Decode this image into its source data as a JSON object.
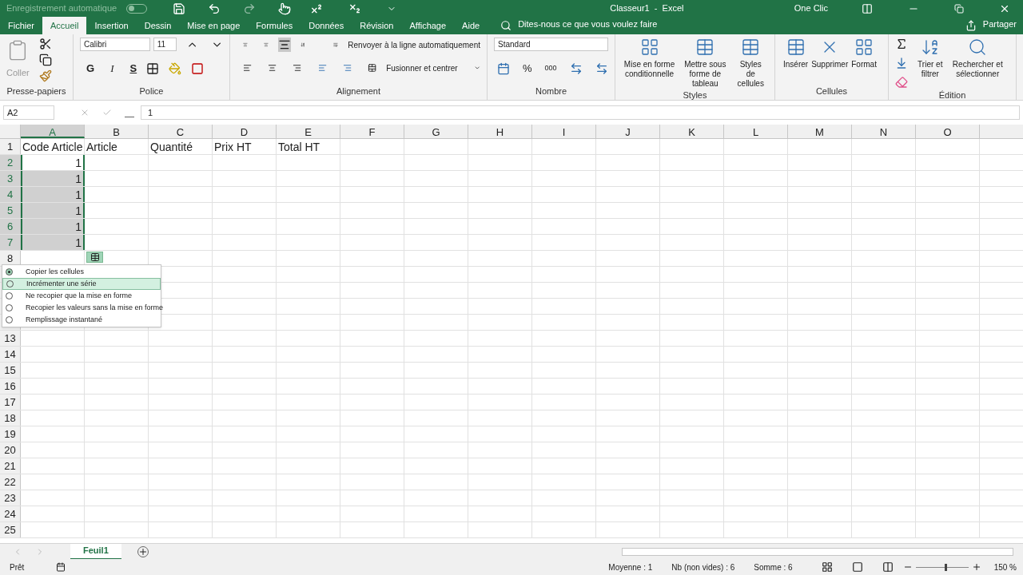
{
  "title_bar": {
    "autosave_label": "Enregistrement automatique",
    "autosave_on": false,
    "title": "Classeur1  -  Excel",
    "user": "One Clic"
  },
  "menu_tabs": [
    {
      "label": "Fichier",
      "selected": false
    },
    {
      "label": "Accueil",
      "selected": true
    },
    {
      "label": "Insertion",
      "selected": false
    },
    {
      "label": "Dessin",
      "selected": false
    },
    {
      "label": "Mise en page",
      "selected": false
    },
    {
      "label": "Formules",
      "selected": false
    },
    {
      "label": "Données",
      "selected": false
    },
    {
      "label": "Révision",
      "selected": false
    },
    {
      "label": "Affichage",
      "selected": false
    },
    {
      "label": "Aide",
      "selected": false
    }
  ],
  "tell_me": "Dites-nous ce que vous voulez faire",
  "share": "Partager",
  "ribbon": {
    "clipboard": {
      "paste": "Coller",
      "label": "Presse-papiers"
    },
    "font": {
      "name": "Calibri",
      "size": "11",
      "bold": "G",
      "italic": "I",
      "underline": "S",
      "label": "Police"
    },
    "alignment": {
      "wrap": "Renvoyer à la ligne automatiquement",
      "merge": "Fusionner et centrer",
      "label": "Alignement"
    },
    "number": {
      "format": "Standard",
      "percent": "%",
      "thousands": "000",
      "label": "Nombre"
    },
    "styles": {
      "buttons": [
        "Mise en forme conditionnelle",
        "Mettre sous forme de tableau",
        "Styles de cellules"
      ],
      "label": "Styles"
    },
    "cells": {
      "buttons": [
        "Insérer",
        "Supprimer",
        "Format"
      ],
      "label": "Cellules"
    },
    "editing": {
      "buttons": [
        "Trier et filtrer",
        "Rechercher et sélectionner"
      ],
      "label": "Édition"
    }
  },
  "formula_bar": {
    "name_box": "A2",
    "value": "1"
  },
  "columns": [
    {
      "label": "A",
      "selected": true
    },
    {
      "label": "B",
      "selected": false
    },
    {
      "label": "C",
      "selected": false
    },
    {
      "label": "D",
      "selected": false
    },
    {
      "label": "E",
      "selected": false
    },
    {
      "label": "F",
      "selected": false
    },
    {
      "label": "G",
      "selected": false
    },
    {
      "label": "H",
      "selected": false
    },
    {
      "label": "I",
      "selected": false
    },
    {
      "label": "J",
      "selected": false
    },
    {
      "label": "K",
      "selected": false
    },
    {
      "label": "L",
      "selected": false
    },
    {
      "label": "M",
      "selected": false
    },
    {
      "label": "N",
      "selected": false
    },
    {
      "label": "O",
      "selected": false
    }
  ],
  "rows": [
    {
      "number": "1",
      "selected": false,
      "cells": [
        "Code Article",
        "Article",
        "Quantité",
        "Prix HT",
        "Total HT"
      ]
    },
    {
      "number": "2",
      "selected": true,
      "active": true,
      "cells": [
        {
          "text": "1",
          "numeric": true
        }
      ]
    },
    {
      "number": "3",
      "selected": true,
      "active": false,
      "cells": [
        {
          "text": "1",
          "numeric": true
        }
      ]
    },
    {
      "number": "4",
      "selected": true,
      "active": false,
      "cells": [
        {
          "text": "1",
          "numeric": true
        }
      ]
    },
    {
      "number": "5",
      "selected": true,
      "active": false,
      "cells": [
        {
          "text": "1",
          "numeric": true
        }
      ]
    },
    {
      "number": "6",
      "selected": true,
      "active": false,
      "cells": [
        {
          "text": "1",
          "numeric": true
        }
      ]
    },
    {
      "number": "7",
      "selected": true,
      "active": false,
      "cells": [
        {
          "text": "1",
          "numeric": true
        }
      ]
    },
    {
      "number": "8",
      "selected": false,
      "cells": []
    },
    {
      "selected": false,
      "cells": []
    },
    {
      "selected": false,
      "cells": []
    },
    {
      "selected": false,
      "cells": []
    },
    {
      "selected": false,
      "cells": []
    },
    {
      "number": "13",
      "selected": false,
      "cells": []
    },
    {
      "number": "14",
      "selected": false,
      "cells": []
    },
    {
      "number": "15",
      "selected": false,
      "cells": []
    },
    {
      "number": "16",
      "selected": false,
      "cells": []
    },
    {
      "number": "17",
      "selected": false,
      "cells": []
    },
    {
      "number": "18",
      "selected": false,
      "cells": []
    },
    {
      "number": "19",
      "selected": false,
      "cells": []
    },
    {
      "number": "20",
      "selected": false,
      "cells": []
    },
    {
      "number": "21",
      "selected": false,
      "cells": []
    },
    {
      "number": "22",
      "selected": false,
      "cells": []
    },
    {
      "number": "23",
      "selected": false,
      "cells": []
    },
    {
      "number": "24",
      "selected": false,
      "cells": []
    },
    {
      "number": "25",
      "selected": false,
      "cells": []
    }
  ],
  "fill_menu": [
    {
      "label": "Copier les cellules",
      "selected": true,
      "highlighted": false
    },
    {
      "label": "Incrémenter une série",
      "selected": false,
      "highlighted": true
    },
    {
      "label": "Ne recopier que la mise en forme",
      "selected": false,
      "highlighted": false
    },
    {
      "label": "Recopier les valeurs sans la mise en forme",
      "selected": false,
      "highlighted": false
    },
    {
      "label": "Remplissage instantané",
      "selected": false,
      "highlighted": false
    }
  ],
  "sheet_tabs": [
    {
      "label": "Feuil1",
      "selected": true
    }
  ],
  "status_bar": {
    "ready": "Prêt",
    "stats": [
      "Moyenne : 1",
      "Nb (non vides) : 6",
      "Somme : 6"
    ],
    "zoom": "150 %",
    "zoom_level": {
      "level": 0.55
    }
  }
}
